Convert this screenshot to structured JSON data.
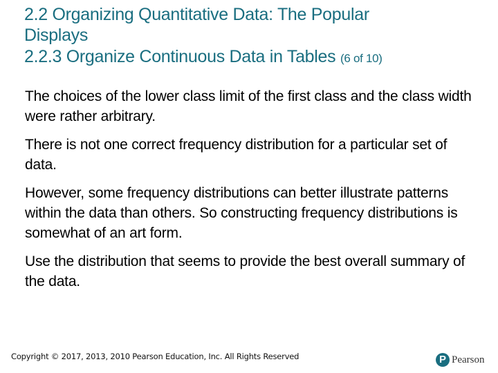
{
  "header": {
    "title": "2.2 Organizing Quantitative Data: The Popular",
    "title_cont": "Displays",
    "subtitle": "2.2.3 Organize Continuous Data in Tables",
    "slide_count": "(6 of 10)"
  },
  "body": {
    "paragraphs": [
      "The choices of the lower class limit of the first class and the class width were rather arbitrary.",
      "There is not one correct frequency distribution for a particular set of data.",
      "However, some frequency distributions can better illustrate patterns within the data than others. So constructing frequency distributions is somewhat of an art form.",
      "Use the distribution that seems to provide the best overall summary of the data."
    ]
  },
  "footer": {
    "copyright": "Copyright © 2017, 2013, 2010 Pearson Education, Inc. All Rights Reserved",
    "logo_mark": "P",
    "logo_text": "Pearson"
  },
  "colors": {
    "title": "#1a6e80",
    "body_text": "#000000",
    "logo": "#1a6e80"
  }
}
